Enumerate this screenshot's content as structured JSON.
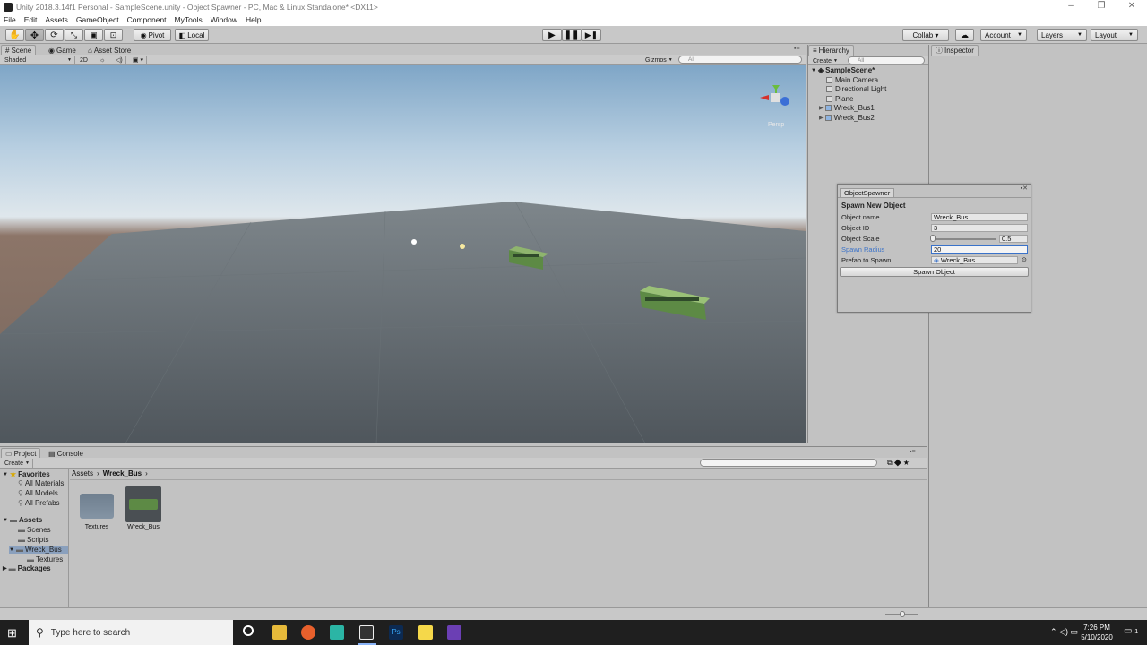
{
  "window": {
    "title": "Unity 2018.3.14f1 Personal - SampleScene.unity - Object Spawner - PC, Mac & Linux Standalone* <DX11>",
    "controls": [
      "–",
      "❐",
      "✕"
    ]
  },
  "menu": [
    "File",
    "Edit",
    "Assets",
    "GameObject",
    "Component",
    "MyTools",
    "Window",
    "Help"
  ],
  "toolbar": {
    "pivot": "Pivot",
    "local": "Local",
    "collab": "Collab ▾",
    "account": "Account",
    "layers": "Layers",
    "layout": "Layout"
  },
  "scene_tabs": [
    "Scene",
    "Game",
    "Asset Store"
  ],
  "scene_bar": {
    "shading": "Shaded",
    "mode_2d": "2D",
    "gizmos": "Gizmos",
    "search_placeholder": "All"
  },
  "gizmo_label": "Persp",
  "hierarchy": {
    "tab": "Hierarchy",
    "create": "Create",
    "search_placeholder": "All",
    "scene": "SampleScene*",
    "items": [
      "Main Camera",
      "Directional Light",
      "Plane",
      "Wreck_Bus1",
      "Wreck_Bus2"
    ]
  },
  "inspector": {
    "tab": "Inspector"
  },
  "spawner": {
    "tab": "ObjectSpawner",
    "heading": "Spawn New Object",
    "fields": [
      {
        "label": "Object name",
        "value": "Wreck_Bus"
      },
      {
        "label": "Object ID",
        "value": "3"
      },
      {
        "label": "Object Scale",
        "value": "0.5"
      },
      {
        "label": "Spawn Radius",
        "value": "20"
      },
      {
        "label": "Prefab to Spawn",
        "value": "Wreck_Bus"
      }
    ],
    "scale_fraction": 0.02,
    "button": "Spawn Object"
  },
  "project": {
    "tabs": [
      "Project",
      "Console"
    ],
    "create": "Create",
    "breadcrumb": [
      "Assets",
      "Wreck_Bus"
    ],
    "favorites_label": "Favorites",
    "favorites": [
      "All Materials",
      "All Models",
      "All Prefabs"
    ],
    "assets_label": "Assets",
    "tree": [
      "Scenes",
      "Scripts",
      "Wreck_Bus",
      "Textures"
    ],
    "packages_label": "Packages",
    "grid_items": [
      "Textures",
      "Wreck_Bus"
    ]
  },
  "taskbar": {
    "search_placeholder": "Type here to search",
    "time": "7:26 PM",
    "date": "5/10/2020",
    "notification_count": "1"
  },
  "colors": {
    "accent_blue": "#3a72c9",
    "sky_top": "#7fa6c7",
    "ground": "#76655c",
    "plane": "#5b6268",
    "bus_green": "#5d8a45"
  }
}
